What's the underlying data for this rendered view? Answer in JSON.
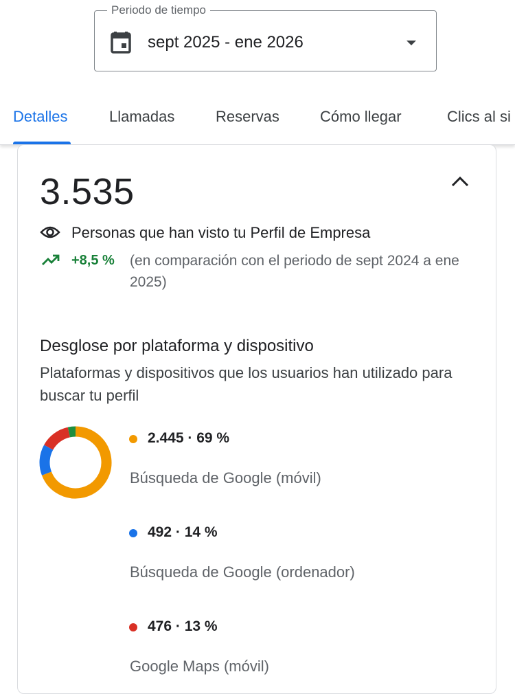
{
  "period": {
    "label": "Periodo de tiempo",
    "value": "sept 2025 - ene 2026",
    "icon": "calendar-icon"
  },
  "tabs": [
    {
      "label": "Detalles",
      "active": true
    },
    {
      "label": "Llamadas",
      "active": false
    },
    {
      "label": "Reservas",
      "active": false
    },
    {
      "label": "Cómo llegar",
      "active": false
    },
    {
      "label": "Clics al si",
      "active": false
    }
  ],
  "summary": {
    "total": "3.535",
    "label": "Personas que han visto tu Perfil de Empresa",
    "trend": "+8,5 %",
    "comparison": "(en comparación con el periodo de sept 2024 a ene 2025)"
  },
  "breakdown": {
    "title": "Desglose por plataforma y dispositivo",
    "description": "Plataformas y dispositivos que los usuarios han utilizado para buscar tu perfil",
    "items": [
      {
        "stat": "2.445 · 69 %",
        "label": "Búsqueda de Google (móvil)",
        "color": "#f29900",
        "value": 2445
      },
      {
        "stat": "492 · 14 %",
        "label": "Búsqueda de Google (ordenador)",
        "color": "#1a73e8",
        "value": 492
      },
      {
        "stat": "476 · 13 %",
        "label": "Google Maps (móvil)",
        "color": "#d93025",
        "value": 476
      }
    ],
    "remainder": {
      "color": "#1e8e3e",
      "value": 122
    }
  },
  "colors": {
    "accent": "#1a73e8",
    "positive": "#188038"
  }
}
